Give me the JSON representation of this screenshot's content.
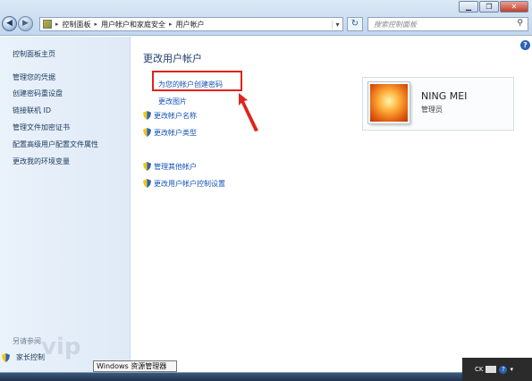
{
  "window": {
    "minimize": "▁",
    "maximize": "❐",
    "close": "✕"
  },
  "address": {
    "crumbs": [
      "控制面板",
      "用户帐户和家庭安全",
      "用户帐户"
    ],
    "search_placeholder": "搜索控制面板"
  },
  "leftnav": {
    "items": [
      "控制面板主页",
      "管理您的凭据",
      "创建密码重设盘",
      "链接联机 ID",
      "管理文件加密证书",
      "配置高级用户配置文件属性",
      "更改我的环境变量"
    ],
    "see_also": "另请参阅",
    "parental": "家长控制",
    "watermark": "vip"
  },
  "main": {
    "title": "更改用户帐户",
    "links": [
      "为您的帐户创建密码",
      "更改图片",
      "更改帐户名称",
      "更改帐户类型"
    ],
    "other_links": [
      "管理其他帐户",
      "更改用户帐户控制设置"
    ]
  },
  "user": {
    "name": "NING MEI",
    "role": "管理员"
  },
  "taskbar": {
    "tooltip": "Windows 资源管理器",
    "tray_lang": "CK"
  },
  "colors": {
    "link": "#1553b6",
    "highlight": "#e0231c",
    "nav_text": "#1b3a5e"
  }
}
